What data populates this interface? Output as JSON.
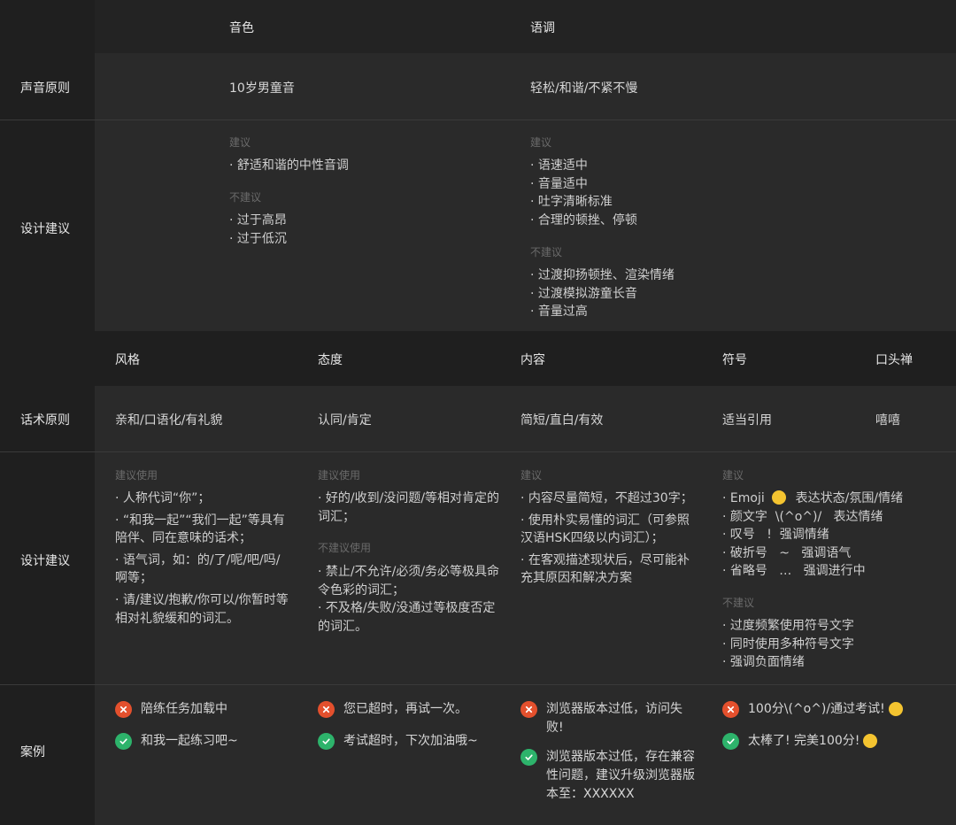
{
  "voice": {
    "headers": {
      "timbre": "音色",
      "tone": "语调"
    },
    "principle": {
      "label": "声音原则",
      "timbre": "10岁男童音",
      "tone": "轻松/和谐/不紧不慢"
    },
    "design": {
      "label": "设计建议",
      "timbre": {
        "do_title": "建议",
        "do": [
          "· 舒适和谐的中性音调"
        ],
        "dont_title": "不建议",
        "dont": [
          "· 过于高昂",
          "· 过于低沉"
        ]
      },
      "tone": {
        "do_title": "建议",
        "do": [
          "· 语速适中",
          "· 音量适中",
          "· 吐字清晰标准",
          "· 合理的顿挫、停顿"
        ],
        "dont_title": "不建议",
        "dont": [
          "· 过渡抑扬顿挫、渲染情绪",
          "· 过渡模拟游童长音",
          "· 音量过高"
        ]
      }
    }
  },
  "speech": {
    "headers": {
      "style": "风格",
      "attitude": "态度",
      "content": "内容",
      "symbol": "符号",
      "catchphrase": "口头禅"
    },
    "principle": {
      "label": "话术原则",
      "style": "亲和/口语化/有礼貌",
      "attitude": "认同/肯定",
      "content": "简短/直白/有效",
      "symbol": "适当引用",
      "catchphrase": "嘻嘻"
    },
    "design": {
      "label": "设计建议",
      "style": {
        "do_title": "建议使用",
        "items": [
          "· 人称代词“你”；",
          "· “和我一起”“我们一起”等具有陪伴、同在意味的话术；",
          "· 语气词，如：的/了/呢/吧/吗/啊等；",
          "· 请/建议/抱歉/你可以/你暂时等相对礼貌缓和的词汇。"
        ]
      },
      "attitude": {
        "do_title": "建议使用",
        "do": [
          "· 好的/收到/没问题/等相对肯定的词汇；"
        ],
        "dont_title": "不建议使用",
        "dont": [
          "· 禁止/不允许/必须/务必等极具命令色彩的词汇；",
          "· 不及格/失败/没通过等极度否定的词汇。"
        ]
      },
      "content": {
        "do_title": "建议",
        "items": [
          "· 内容尽量简短，不超过30字；",
          "· 使用朴实易懂的词汇（可参照汉语HSK四级以内词汇）；",
          "· 在客观描述现状后，尽可能补充其原因和解决方案"
        ]
      },
      "symbol": {
        "do_title": "建议",
        "do": [
          "· Emoji",
          "· 颜文字  \\(^o^)/   表达情绪",
          "· 叹号   !  强调情绪",
          "· 破折号   ~   强调语气",
          "· 省略号   …   强调进行中"
        ],
        "emoji_suffix": "表达状态/氛围/情绪",
        "dont_title": "不建议",
        "dont": [
          "· 过度频繁使用符号文字",
          "· 同时使用多种符号文字",
          "· 强调负面情绪"
        ]
      }
    },
    "cases": {
      "label": "案例",
      "style": {
        "bad": "陪练任务加载中",
        "good": "和我一起练习吧~"
      },
      "attitude": {
        "bad": "您已超时，再试一次。",
        "good": "考试超时，下次加油哦~"
      },
      "content": {
        "bad": "浏览器版本过低，访问失败!",
        "good": "浏览器版本过低，存在兼容性问题，建议升级浏览器版本至：XXXXXX"
      },
      "symbol": {
        "bad": "100分\\(^o^)/通过考试!",
        "good": "太棒了! 完美100分!"
      }
    }
  },
  "colors": {
    "bad": "#e4502d",
    "good": "#2db36b",
    "emoji": "#f4c430"
  }
}
